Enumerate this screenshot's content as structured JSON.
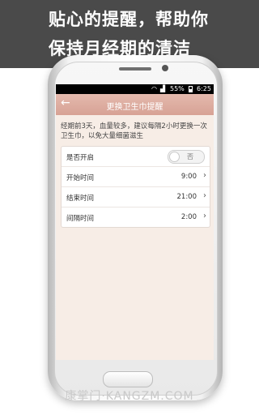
{
  "banner": {
    "line1": "贴心的提醒，帮助你",
    "line2": "保持月经期的清洁"
  },
  "status": {
    "wifi_icon": "wifi-icon",
    "signal_icon": "signal-icon",
    "battery": "55%",
    "time": "6:25"
  },
  "header": {
    "back_icon": "←",
    "title": "更换卫生巾提醒"
  },
  "note": "经期前3天，血量较多，建议每隔2小时更换一次卫生巾，以免大量细菌滋生",
  "settings": {
    "enable": {
      "label": "是否开启",
      "toggle_text": "否",
      "on": false
    },
    "start": {
      "label": "开始时间",
      "value": "9:00"
    },
    "end": {
      "label": "结束时间",
      "value": "21:00"
    },
    "interval": {
      "label": "间隔时间",
      "value": "2:00"
    }
  },
  "watermark": "康掌门·KANGZM.COM"
}
